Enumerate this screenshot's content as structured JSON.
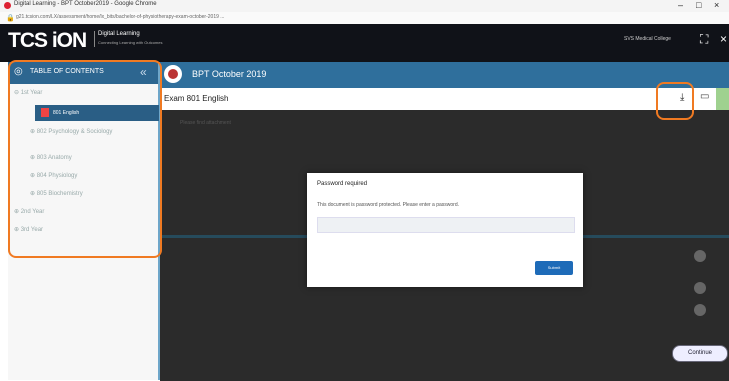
{
  "browser": {
    "window_title": "Digital Learning - BPT October2019 - Google Chrome",
    "url": "g21.tcsion.com/LX/assessment/home/lx_bits/bachelor-of-physiotherapy-exam-october-2019 ...",
    "controls": [
      "–",
      "□",
      "×"
    ]
  },
  "header": {
    "brand": "TCS iON",
    "product": "Digital Learning",
    "tagline": "Connecting Learning with Outcomes",
    "user": "SVS Medical College",
    "expand_icon": "expand-icon",
    "close_icon": "close-icon"
  },
  "sidebar": {
    "toc_label": "TABLE OF CONTENTS",
    "items": [
      {
        "label": "1st Year"
      },
      {
        "label": "801 English"
      },
      {
        "label": "802 Psychology & Sociology"
      },
      {
        "label": "803 Anatomy"
      },
      {
        "label": "804 Physiology"
      },
      {
        "label": "805 Biochemistry"
      },
      {
        "label": "2nd Year"
      },
      {
        "label": "3rd Year"
      }
    ]
  },
  "main": {
    "course_title": "BPT October 2019",
    "doc_title": "Exam 801 English",
    "viewer_placeholder": "Please find attachment",
    "continue_label": "Continue"
  },
  "modal": {
    "title": "Password required",
    "message": "This document is password protected. Please enter a password.",
    "submit_label": "Submit"
  },
  "colors": {
    "highlight": "#f07a22",
    "accent": "#2f6f9c",
    "submit": "#1e6bb8"
  }
}
